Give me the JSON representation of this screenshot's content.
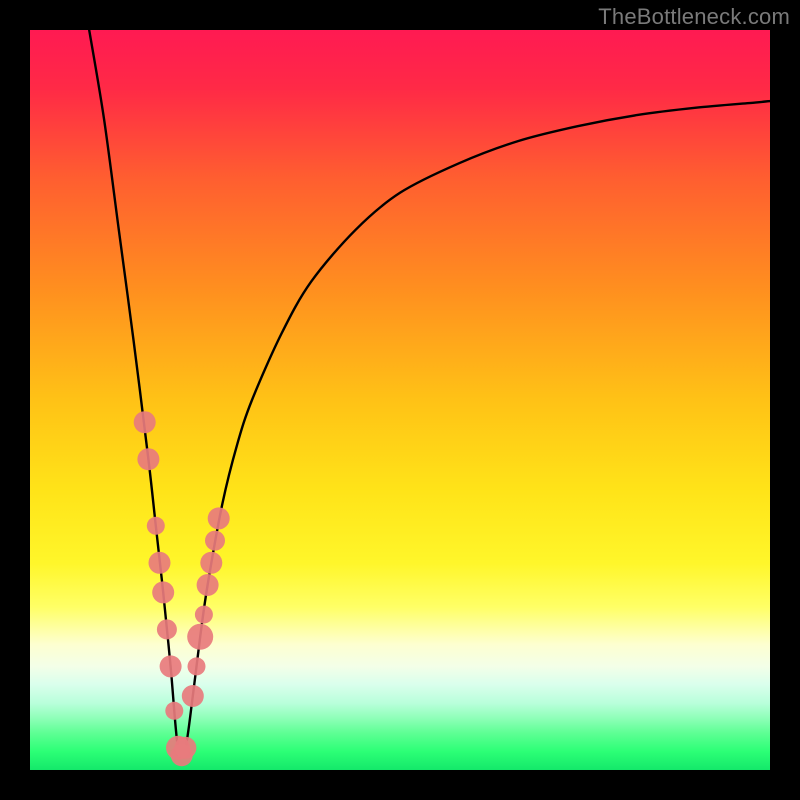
{
  "watermark": "TheBottleneck.com",
  "chart_data": {
    "type": "line",
    "title": "",
    "xlabel": "",
    "ylabel": "",
    "xlim": [
      0,
      100
    ],
    "ylim": [
      0,
      100
    ],
    "gradient_stops": [
      {
        "offset": 0.0,
        "color": "#ff1a52"
      },
      {
        "offset": 0.08,
        "color": "#ff2a46"
      },
      {
        "offset": 0.2,
        "color": "#ff5e30"
      },
      {
        "offset": 0.35,
        "color": "#ff8f1f"
      },
      {
        "offset": 0.5,
        "color": "#ffc216"
      },
      {
        "offset": 0.62,
        "color": "#ffe318"
      },
      {
        "offset": 0.72,
        "color": "#fff62a"
      },
      {
        "offset": 0.78,
        "color": "#ffff66"
      },
      {
        "offset": 0.83,
        "color": "#fdffd0"
      },
      {
        "offset": 0.86,
        "color": "#f3ffe8"
      },
      {
        "offset": 0.885,
        "color": "#d9ffec"
      },
      {
        "offset": 0.91,
        "color": "#b8ffda"
      },
      {
        "offset": 0.93,
        "color": "#8effb8"
      },
      {
        "offset": 0.95,
        "color": "#5eff94"
      },
      {
        "offset": 0.975,
        "color": "#2cff76"
      },
      {
        "offset": 1.0,
        "color": "#14e86a"
      }
    ],
    "minimum_x": 20,
    "series": [
      {
        "name": "bottleneck-curve",
        "x": [
          8,
          10,
          12,
          14,
          16,
          17,
          18,
          19,
          20,
          21,
          22,
          23,
          24,
          26,
          28,
          30,
          34,
          38,
          44,
          50,
          58,
          66,
          74,
          82,
          90,
          98,
          100
        ],
        "values": [
          100,
          88,
          73,
          58,
          42,
          33,
          24,
          14,
          3,
          3,
          10,
          18,
          25,
          36,
          44,
          50,
          59,
          66,
          73,
          78,
          82,
          85,
          87,
          88.5,
          89.5,
          90.2,
          90.4
        ]
      }
    ],
    "markers": {
      "name": "sample-points",
      "color": "#e87b7d",
      "x": [
        15.5,
        16.0,
        17.0,
        17.5,
        18.0,
        18.5,
        19.0,
        19.5,
        20.0,
        20.5,
        21.0,
        22.0,
        22.5,
        23.0,
        23.5,
        24.0,
        24.5,
        25.0,
        25.5
      ],
      "values": [
        47,
        42,
        33,
        28,
        24,
        19,
        14,
        8,
        3,
        2,
        3,
        10,
        14,
        18,
        21,
        25,
        28,
        31,
        34
      ],
      "r": [
        11,
        11,
        9,
        11,
        11,
        10,
        11,
        9,
        12,
        11,
        11,
        11,
        9,
        13,
        9,
        11,
        11,
        10,
        11
      ]
    }
  }
}
